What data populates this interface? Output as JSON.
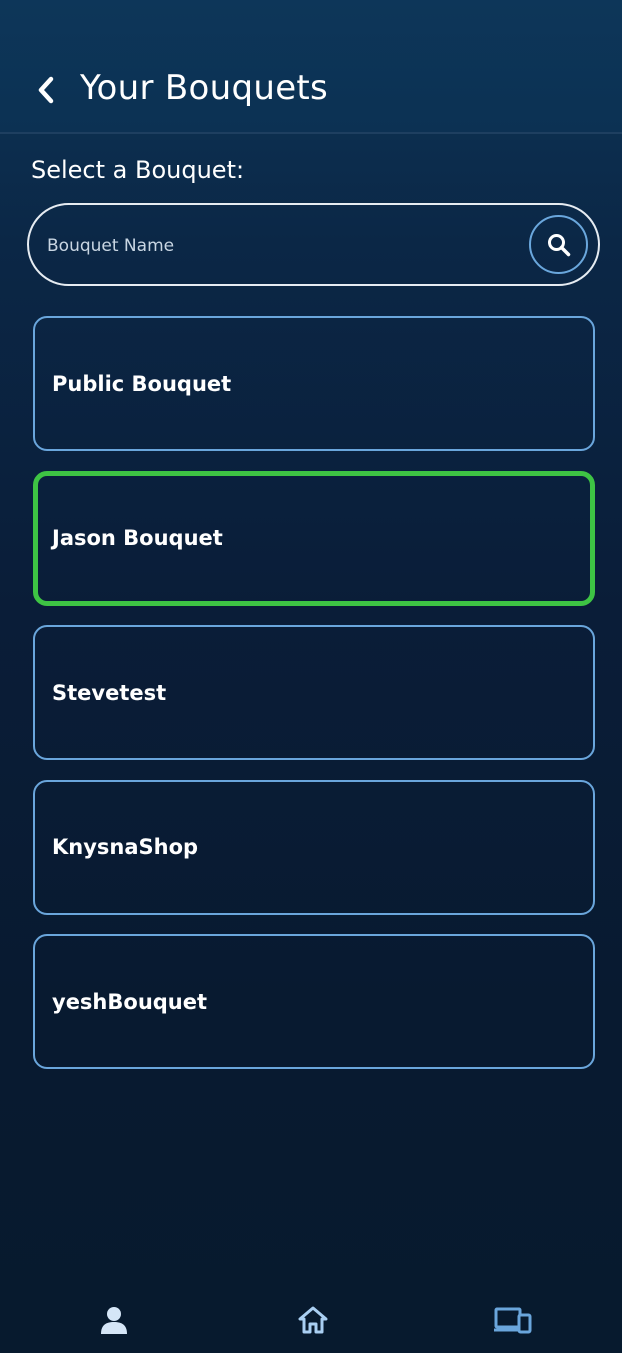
{
  "header": {
    "title": "Your Bouquets",
    "back_icon": "chevron-left-icon"
  },
  "search": {
    "label": "Select a Bouquet:",
    "placeholder": "Bouquet Name",
    "value": "",
    "icon": "search-icon"
  },
  "bouquets": [
    {
      "name": "Public Bouquet",
      "selected": false
    },
    {
      "name": "Jason Bouquet",
      "selected": true
    },
    {
      "name": "Stevetest",
      "selected": false
    },
    {
      "name": "KnysnaShop",
      "selected": false
    },
    {
      "name": "yeshBouquet",
      "selected": false
    }
  ],
  "bottom_nav": {
    "items": [
      {
        "icon": "profile-icon"
      },
      {
        "icon": "home-icon"
      },
      {
        "icon": "devices-icon"
      }
    ]
  },
  "colors": {
    "accent": "#6aa6dc",
    "selected_border": "#3ec444",
    "background_top": "#0d3659",
    "background_bottom": "#071a2e"
  }
}
